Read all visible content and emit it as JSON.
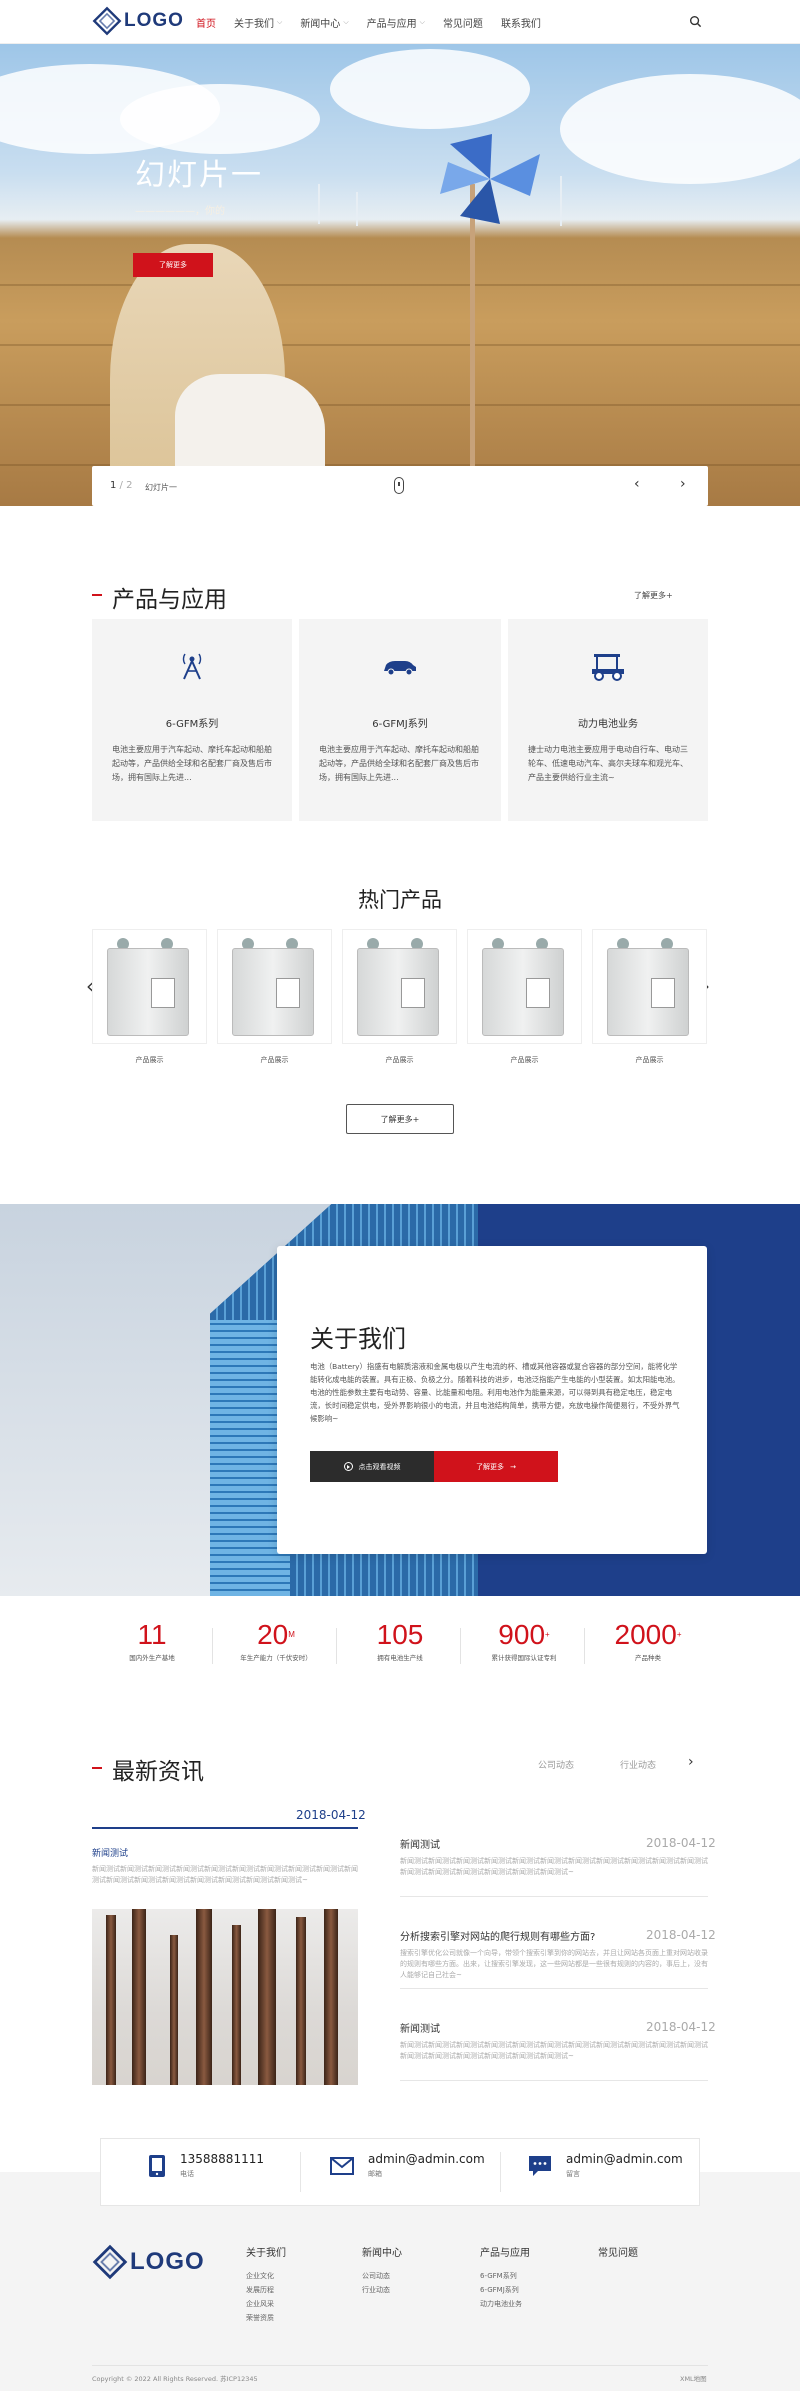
{
  "header": {
    "logo_text": "LOGO",
    "nav": [
      {
        "label": "首页",
        "active": true,
        "has_caret": false
      },
      {
        "label": "关于我们",
        "active": false,
        "has_caret": true
      },
      {
        "label": "新闻中心",
        "active": false,
        "has_caret": true
      },
      {
        "label": "产品与应用",
        "active": false,
        "has_caret": true
      },
      {
        "label": "常见问题",
        "active": false,
        "has_caret": false
      },
      {
        "label": "联系我们",
        "active": false,
        "has_caret": false
      }
    ],
    "search_icon": "search-icon"
  },
  "hero": {
    "title": "幻灯片一",
    "subtitle": "——————，你的",
    "button_label": "了解更多",
    "pager_current": "1",
    "pager_sep": " / ",
    "pager_total": "2",
    "slide_label": "幻灯片一",
    "prev_icon": "chevron-left-icon",
    "next_icon": "chevron-right-icon"
  },
  "products": {
    "title": "产品与应用",
    "more": "了解更多+",
    "cards": [
      {
        "icon": "antenna-icon",
        "title": "6-GFM系列",
        "desc": "电池主要应用于汽车起动、摩托车起动和船舶起动等，产品供给全球和名配套厂商及售后市场，拥有国际上先进..."
      },
      {
        "icon": "car-icon",
        "title": "6-GFMJ系列",
        "desc": "电池主要应用于汽车起动、摩托车起动和船舶起动等，产品供给全球和名配套厂商及售后市场，拥有国际上先进..."
      },
      {
        "icon": "golf-cart-icon",
        "title": "动力电池业务",
        "desc": "捷士动力电池主要应用于电动自行车、电动三轮车、低速电动汽车、高尔夫球车和观光车、产品主要供给行业主流~"
      }
    ]
  },
  "hot": {
    "title": "热门产品",
    "items": [
      {
        "label": "产品展示"
      },
      {
        "label": "产品展示"
      },
      {
        "label": "产品展示"
      },
      {
        "label": "产品展示"
      },
      {
        "label": "产品展示"
      }
    ],
    "more": "了解更多+",
    "prev_icon": "chevron-left-icon",
    "next_icon": "chevron-right-icon"
  },
  "about": {
    "title": "关于我们",
    "text": "电池（Battery）指盛有电解质溶液和金属电极以产生电流的杯、槽或其他容器或复合容器的部分空间，能将化学能转化成电能的装置。具有正极、负极之分。随着科技的进步，电池泛指能产生电能的小型装置。如太阳能电池。电池的性能参数主要有电动势、容量、比能量和电阻。利用电池作为能量来源，可以得到具有稳定电压，稳定电流，长时间稳定供电，受外界影响很小的电流，并且电池结构简单，携带方便，充放电操作简便易行，不受外界气候影响~",
    "video_label": "点击观看视频",
    "more_label": "了解更多"
  },
  "stats": [
    {
      "num": "11",
      "sup": "",
      "label": "国内外生产基地"
    },
    {
      "num": "20",
      "sup": "M",
      "label": "年生产能力（千伏安时）"
    },
    {
      "num": "105",
      "sup": "",
      "label": "拥有电池生产线"
    },
    {
      "num": "900",
      "sup": "+",
      "label": "累计获得国际认证专利"
    },
    {
      "num": "2000",
      "sup": "+",
      "label": "产品种类"
    }
  ],
  "news": {
    "title": "最新资讯",
    "tabs": [
      "公司动态",
      "行业动态"
    ],
    "next_icon": "chevron-right-icon",
    "featured": {
      "date": "2018-04-12",
      "title": "新闻测试",
      "text": "新闻测试新闻测试新闻测试新闻测试新闻测试新闻测试新闻测试新闻测试新闻测试新闻测试新闻测试新闻测试新闻测试新闻测试新闻测试新闻测试新闻测试~"
    },
    "items": [
      {
        "title": "新闻测试",
        "date": "2018-04-12",
        "text": "新闻测试新闻测试新闻测试新闻测试新闻测试新闻测试新闻测试新闻测试新闻测试新闻测试新闻测试新闻测试新闻测试新闻测试新闻测试新闻测试新闻测试~"
      },
      {
        "title": "分析搜索引擎对网站的爬行规则有哪些方面?",
        "date": "2018-04-12",
        "text": "搜索引擎优化公司就像一个向导，带领个搜索引擎到你的网站去，并且让网站各页面上重对网站收录的规则有哪些方面。出来，让搜索引擎发现，这一些网站都是一些很有规则的内容的，事后上，没有人能够记自己社会~"
      },
      {
        "title": "新闻测试",
        "date": "2018-04-12",
        "text": "新闻测试新闻测试新闻测试新闻测试新闻测试新闻测试新闻测试新闻测试新闻测试新闻测试新闻测试新闻测试新闻测试新闻测试新闻测试新闻测试新闻测试~"
      }
    ]
  },
  "contact": [
    {
      "icon": "phone-icon",
      "main": "13588881111",
      "sub": "电话"
    },
    {
      "icon": "mail-icon",
      "main": "admin@admin.com",
      "sub": "邮箱"
    },
    {
      "icon": "chat-icon",
      "main": "admin@admin.com",
      "sub": "留言"
    }
  ],
  "footer": {
    "logo_text": "LOGO",
    "cols": [
      {
        "head": "关于我们",
        "links": [
          "企业文化",
          "发展历程",
          "企业风采",
          "荣誉资质"
        ]
      },
      {
        "head": "新闻中心",
        "links": [
          "公司动态",
          "行业动态"
        ]
      },
      {
        "head": "产品与应用",
        "links": [
          "6-GFM系列",
          "6-GFMJ系列",
          "动力电池业务"
        ]
      },
      {
        "head": "常见问题",
        "links": []
      }
    ],
    "copyright": "Copyright © 2022 All Rights Reserved. 苏ICP12345",
    "sitemap": "XML地图"
  },
  "colors": {
    "accent": "#d0121b",
    "brand": "#1e3f8a"
  }
}
